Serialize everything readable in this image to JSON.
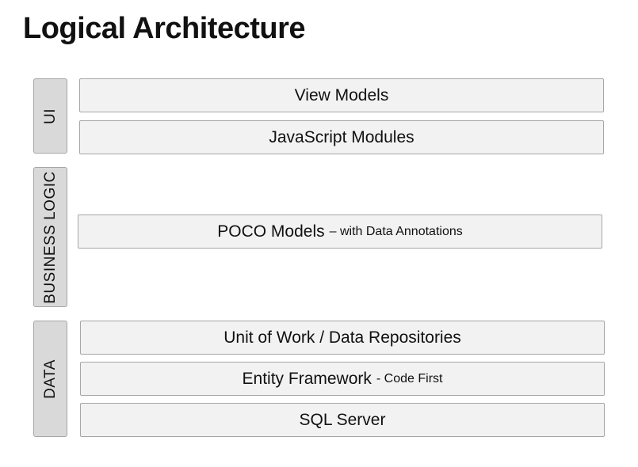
{
  "title": "Logical Architecture",
  "layers": {
    "ui": {
      "label": "UI",
      "boxes": [
        {
          "main": "View Models",
          "suffix": ""
        },
        {
          "main": "JavaScript Modules",
          "suffix": ""
        }
      ]
    },
    "business": {
      "label": "BUSINESS LOGIC",
      "boxes": [
        {
          "main": "POCO Models",
          "suffix": "– with Data Annotations"
        }
      ]
    },
    "data": {
      "label": "DATA",
      "boxes": [
        {
          "main": "Unit of Work / Data Repositories",
          "suffix": ""
        },
        {
          "main": "Entity Framework",
          "suffix": "- Code First"
        },
        {
          "main": "SQL Server",
          "suffix": ""
        }
      ]
    }
  },
  "colors": {
    "tab_fill": "#d9d9d9",
    "box_fill": "#f2f2f2",
    "border": "#a6a6a6"
  }
}
